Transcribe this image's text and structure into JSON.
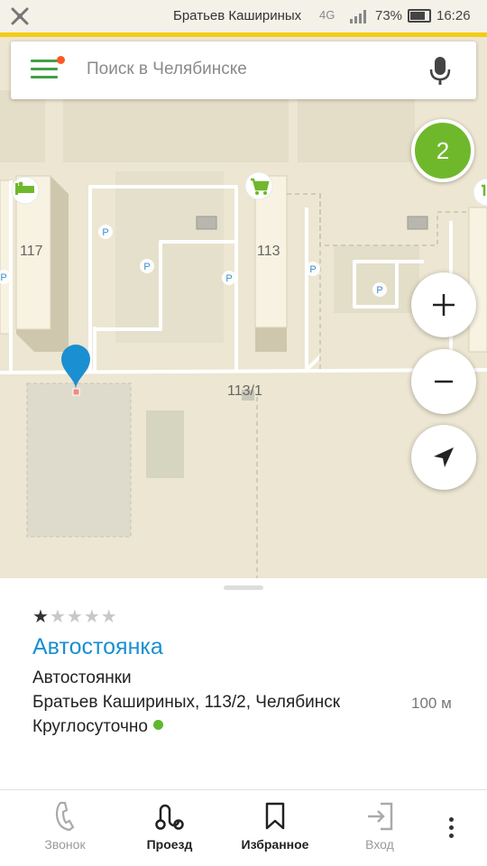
{
  "status_bar": {
    "street": "Братьев Кашириных",
    "network": "4G",
    "battery_percent": "73%",
    "time": "16:26"
  },
  "search": {
    "placeholder": "Поиск в Челябинске",
    "menu_icon": "hamburger-menu-icon",
    "mic_icon": "microphone-icon"
  },
  "map": {
    "building_labels": [
      "117",
      "113",
      "113/1"
    ],
    "parking_marker": "P",
    "poi_icons": [
      "hotel-icon",
      "shopping-cart-icon"
    ],
    "accent_color": "#6fb82c",
    "pin_color": "#1a8fd1"
  },
  "controls": {
    "cluster_count": "2",
    "zoom_in_icon": "plus-icon",
    "zoom_out_icon": "minus-icon",
    "locate_icon": "navigation-arrow-icon"
  },
  "place": {
    "rating": 1,
    "rating_max": 5,
    "title": "Автостоянка",
    "category": "Автостоянки",
    "address": "Братьев Кашириных, 113/2, Челябинск",
    "distance": "100 м",
    "hours": "Круглосуточно",
    "open_status_color": "#5cb82c"
  },
  "bottom_bar": {
    "tabs": [
      {
        "label": "Звонок",
        "icon": "phone-icon",
        "enabled": false
      },
      {
        "label": "Проезд",
        "icon": "route-icon",
        "enabled": true
      },
      {
        "label": "Избранное",
        "icon": "bookmark-icon",
        "enabled": true
      },
      {
        "label": "Вход",
        "icon": "entrance-icon",
        "enabled": false
      }
    ],
    "more_icon": "more-vertical-icon"
  }
}
